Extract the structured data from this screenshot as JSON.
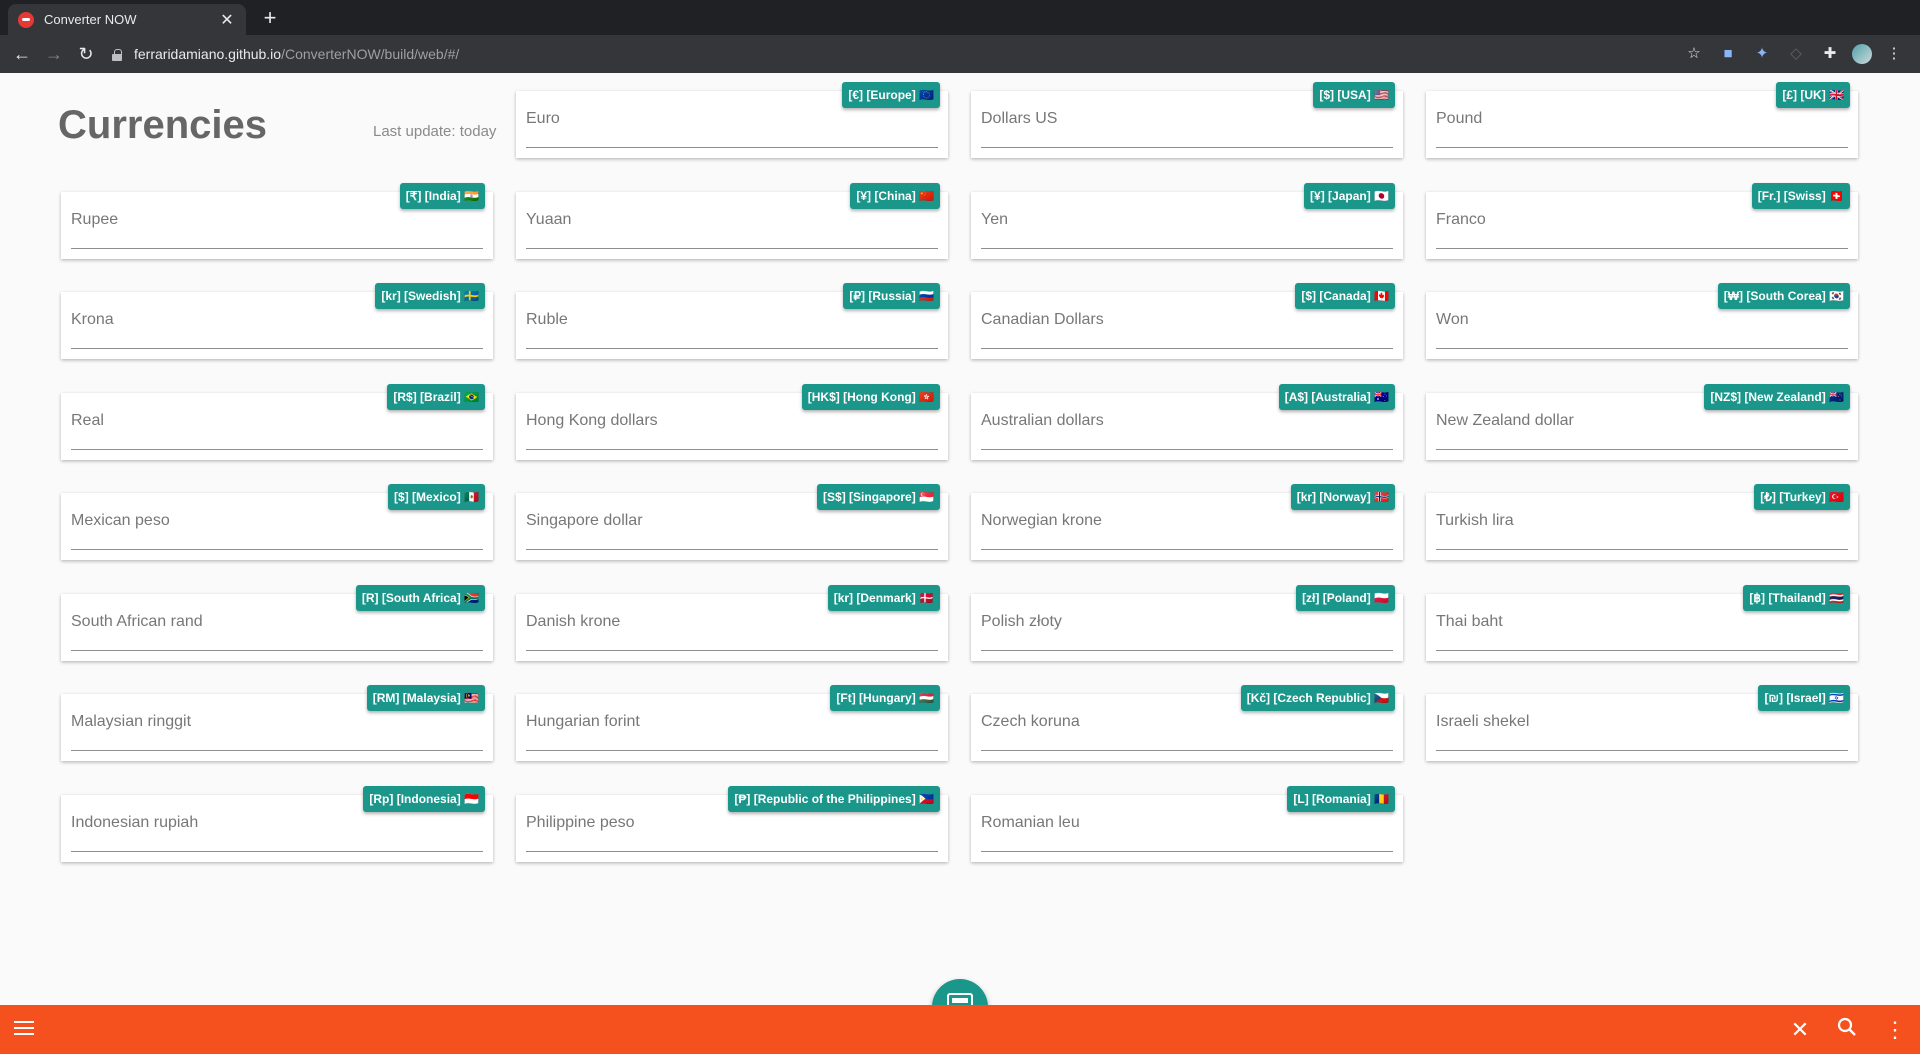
{
  "browser": {
    "tab_title": "Converter NOW",
    "url_host": "ferraridamiano.github.io",
    "url_path": "/ConverterNOW/build/web/#/"
  },
  "page": {
    "title": "Currencies",
    "last_update": "Last update: today"
  },
  "currencies": [
    {
      "name": "Euro",
      "badge": "[€] [Europe] 🇪🇺"
    },
    {
      "name": "Dollars US",
      "badge": "[$] [USA] 🇺🇸"
    },
    {
      "name": "Pound",
      "badge": "[£] [UK] 🇬🇧"
    },
    {
      "name": "Rupee",
      "badge": "[₹] [India] 🇮🇳"
    },
    {
      "name": "Yuaan",
      "badge": "[¥] [China] 🇨🇳"
    },
    {
      "name": "Yen",
      "badge": "[¥] [Japan] 🇯🇵"
    },
    {
      "name": "Franco",
      "badge": "[Fr.] [Swiss] 🇨🇭"
    },
    {
      "name": "Krona",
      "badge": "[kr] [Swedish] 🇸🇪"
    },
    {
      "name": "Ruble",
      "badge": "[₽] [Russia] 🇷🇺"
    },
    {
      "name": "Canadian Dollars",
      "badge": "[$] [Canada] 🇨🇦"
    },
    {
      "name": "Won",
      "badge": "[₩] [South Corea] 🇰🇷"
    },
    {
      "name": "Real",
      "badge": "[R$] [Brazil] 🇧🇷"
    },
    {
      "name": "Hong Kong dollars",
      "badge": "[HK$] [Hong Kong] 🇭🇰"
    },
    {
      "name": "Australian dollars",
      "badge": "[A$] [Australia] 🇦🇺"
    },
    {
      "name": "New Zealand dollar",
      "badge": "[NZ$] [New Zealand] 🇳🇿"
    },
    {
      "name": "Mexican peso",
      "badge": "[$] [Mexico] 🇲🇽"
    },
    {
      "name": "Singapore dollar",
      "badge": "[S$] [Singapore] 🇸🇬"
    },
    {
      "name": "Norwegian krone",
      "badge": "[kr] [Norway] 🇳🇴"
    },
    {
      "name": "Turkish lira",
      "badge": "[₺] [Turkey] 🇹🇷"
    },
    {
      "name": "South African rand",
      "badge": "[R] [South Africa] 🇿🇦"
    },
    {
      "name": "Danish krone",
      "badge": "[kr] [Denmark] 🇩🇰"
    },
    {
      "name": "Polish złoty",
      "badge": "[zł] [Poland] 🇵🇱"
    },
    {
      "name": "Thai baht",
      "badge": "[฿] [Thailand] 🇹🇭"
    },
    {
      "name": "Malaysian ringgit",
      "badge": "[RM] [Malaysia] 🇲🇾"
    },
    {
      "name": "Hungarian forint",
      "badge": "[Ft] [Hungary] 🇭🇺"
    },
    {
      "name": "Czech koruna",
      "badge": "[Kč] [Czech Republic] 🇨🇿"
    },
    {
      "name": "Israeli shekel",
      "badge": "[₪] [Israel] 🇮🇱"
    },
    {
      "name": "Indonesian rupiah",
      "badge": "[Rp] [Indonesia] 🇮🇩"
    },
    {
      "name": "Philippine peso",
      "badge": "[₱] [Republic of the Philippines] 🇵🇭"
    },
    {
      "name": "Romanian leu",
      "badge": "[L] [Romania] 🇷🇴"
    }
  ],
  "colors": {
    "accent": "#1a968b",
    "bottom_bar": "#f4511e"
  },
  "icons": {
    "fab": "calculator-icon",
    "bottom_left": "menu-icon",
    "bottom_right": [
      "close-icon",
      "search-icon",
      "more-vert-icon"
    ]
  }
}
